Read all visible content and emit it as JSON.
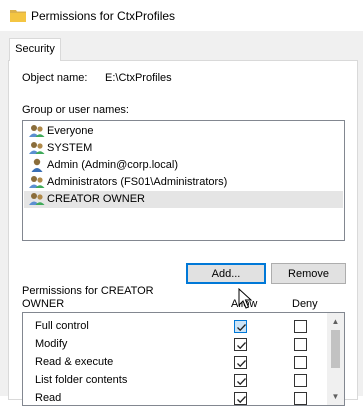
{
  "window": {
    "title": "Permissions for CtxProfiles"
  },
  "tabs": [
    {
      "label": "Security"
    }
  ],
  "object": {
    "label": "Object name:",
    "value": "E:\\CtxProfiles"
  },
  "groups": {
    "label": "Group or user names:",
    "items": [
      {
        "label": "Everyone",
        "icon": "users-group-icon",
        "selected": false
      },
      {
        "label": "SYSTEM",
        "icon": "users-group-icon",
        "selected": false
      },
      {
        "label": "Admin (Admin@corp.local)",
        "icon": "user-icon",
        "selected": false
      },
      {
        "label": "Administrators (FS01\\Administrators)",
        "icon": "users-group-icon",
        "selected": false
      },
      {
        "label": "CREATOR OWNER",
        "icon": "users-group-icon",
        "selected": true
      }
    ]
  },
  "buttons": {
    "add": "Add...",
    "remove": "Remove"
  },
  "permissions": {
    "label": "Permissions for CREATOR OWNER",
    "allow_header": "Allow",
    "deny_header": "Deny",
    "rows": [
      {
        "name": "Full control",
        "allow": true,
        "deny": false
      },
      {
        "name": "Modify",
        "allow": true,
        "deny": false
      },
      {
        "name": "Read & execute",
        "allow": true,
        "deny": false
      },
      {
        "name": "List folder contents",
        "allow": true,
        "deny": false
      },
      {
        "name": "Read",
        "allow": true,
        "deny": false
      },
      {
        "name": "",
        "allow": true,
        "deny": false
      }
    ]
  },
  "colors": {
    "accent": "#0078d7",
    "selection": "#e5e5e5",
    "window_bg": "#f0f0f0",
    "folder": "#f4c542"
  }
}
